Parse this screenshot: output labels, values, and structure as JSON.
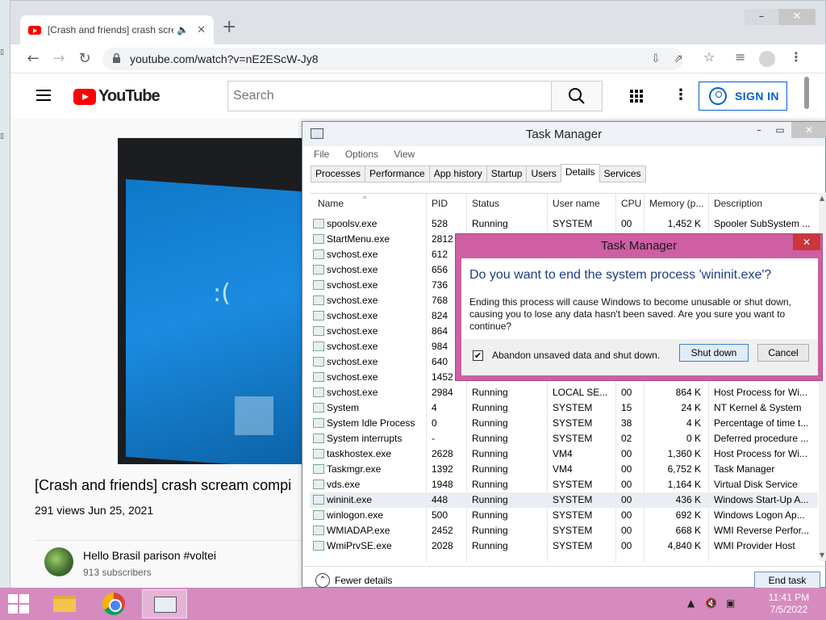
{
  "browser": {
    "tab_title": "[Crash and friends] crash scre",
    "new_tab": "+",
    "url": "youtube.com/watch?v=nE2EScW-Jy8",
    "window_min": "–",
    "window_close": "✕"
  },
  "youtube": {
    "logo_text": "YouTube",
    "search_placeholder": "Search",
    "signin_label": "SIGN IN",
    "video_title": "[Crash and friends] crash scream compi",
    "video_meta": "291 views  Jun 25, 2021",
    "channel_name": "Hello Brasil parison #voltei",
    "channel_subs": "913 subscribers"
  },
  "taskmanager": {
    "title": "Task Manager",
    "menu": [
      "File",
      "Options",
      "View"
    ],
    "tabs": [
      "Processes",
      "Performance",
      "App history",
      "Startup",
      "Users",
      "Details",
      "Services"
    ],
    "active_tab": "Details",
    "columns": [
      "Name",
      "PID",
      "Status",
      "User name",
      "CPU",
      "Memory (p...",
      "Description"
    ],
    "rows": [
      {
        "name": "spoolsv.exe",
        "pid": "528",
        "status": "Running",
        "user": "SYSTEM",
        "cpu": "00",
        "mem": "1,452 K",
        "desc": "Spooler SubSystem ..."
      },
      {
        "name": "StartMenu.exe",
        "pid": "2812",
        "status": "",
        "user": "",
        "cpu": "",
        "mem": "",
        "desc": ""
      },
      {
        "name": "svchost.exe",
        "pid": "612",
        "status": "",
        "user": "",
        "cpu": "",
        "mem": "",
        "desc": ""
      },
      {
        "name": "svchost.exe",
        "pid": "656",
        "status": "",
        "user": "",
        "cpu": "",
        "mem": "",
        "desc": ""
      },
      {
        "name": "svchost.exe",
        "pid": "736",
        "status": "",
        "user": "",
        "cpu": "",
        "mem": "",
        "desc": ""
      },
      {
        "name": "svchost.exe",
        "pid": "768",
        "status": "",
        "user": "",
        "cpu": "",
        "mem": "",
        "desc": ""
      },
      {
        "name": "svchost.exe",
        "pid": "824",
        "status": "",
        "user": "",
        "cpu": "",
        "mem": "",
        "desc": ""
      },
      {
        "name": "svchost.exe",
        "pid": "864",
        "status": "",
        "user": "",
        "cpu": "",
        "mem": "",
        "desc": ""
      },
      {
        "name": "svchost.exe",
        "pid": "984",
        "status": "",
        "user": "",
        "cpu": "",
        "mem": "",
        "desc": ""
      },
      {
        "name": "svchost.exe",
        "pid": "640",
        "status": "",
        "user": "",
        "cpu": "",
        "mem": "",
        "desc": ""
      },
      {
        "name": "svchost.exe",
        "pid": "1452",
        "status": "",
        "user": "",
        "cpu": "",
        "mem": "",
        "desc": ""
      },
      {
        "name": "svchost.exe",
        "pid": "2984",
        "status": "Running",
        "user": "LOCAL SE...",
        "cpu": "00",
        "mem": "864 K",
        "desc": "Host Process for Wi..."
      },
      {
        "name": "System",
        "pid": "4",
        "status": "Running",
        "user": "SYSTEM",
        "cpu": "15",
        "mem": "24 K",
        "desc": "NT Kernel & System"
      },
      {
        "name": "System Idle Process",
        "pid": "0",
        "status": "Running",
        "user": "SYSTEM",
        "cpu": "38",
        "mem": "4 K",
        "desc": "Percentage of time t..."
      },
      {
        "name": "System interrupts",
        "pid": "-",
        "status": "Running",
        "user": "SYSTEM",
        "cpu": "02",
        "mem": "0 K",
        "desc": "Deferred procedure ..."
      },
      {
        "name": "taskhostex.exe",
        "pid": "2628",
        "status": "Running",
        "user": "VM4",
        "cpu": "00",
        "mem": "1,360 K",
        "desc": "Host Process for Wi..."
      },
      {
        "name": "Taskmgr.exe",
        "pid": "1392",
        "status": "Running",
        "user": "VM4",
        "cpu": "00",
        "mem": "6,752 K",
        "desc": "Task Manager"
      },
      {
        "name": "vds.exe",
        "pid": "1948",
        "status": "Running",
        "user": "SYSTEM",
        "cpu": "00",
        "mem": "1,164 K",
        "desc": "Virtual Disk Service"
      },
      {
        "name": "wininit.exe",
        "pid": "448",
        "status": "Running",
        "user": "SYSTEM",
        "cpu": "00",
        "mem": "436 K",
        "desc": "Windows Start-Up A..."
      },
      {
        "name": "winlogon.exe",
        "pid": "500",
        "status": "Running",
        "user": "SYSTEM",
        "cpu": "00",
        "mem": "692 K",
        "desc": "Windows Logon Ap..."
      },
      {
        "name": "WMIADAP.exe",
        "pid": "2452",
        "status": "Running",
        "user": "SYSTEM",
        "cpu": "00",
        "mem": "668 K",
        "desc": "WMI Reverse Perfor..."
      },
      {
        "name": "WmiPrvSE.exe",
        "pid": "2028",
        "status": "Running",
        "user": "SYSTEM",
        "cpu": "00",
        "mem": "4,840 K",
        "desc": "WMI Provider Host"
      }
    ],
    "selected_row": "wininit.exe",
    "fewer_details": "Fewer details",
    "end_task": "End task"
  },
  "dialog": {
    "title": "Task Manager",
    "question": "Do you want to end the system process 'wininit.exe'?",
    "body": "Ending this process will cause Windows to become unusable or shut down, causing you to lose any data hasn't been saved. Are you sure you want to continue?",
    "checkbox_label": "Abandon unsaved data and shut down.",
    "checkbox_checked": true,
    "shutdown_label": "Shut down",
    "cancel_label": "Cancel"
  },
  "taskbar": {
    "time": "11:41 PM",
    "date": "7/5/2022"
  },
  "colors": {
    "dialog_frame": "#cd5fa2",
    "taskbar": "#d68bc0",
    "youtube_red": "#ff0000",
    "signin_blue": "#065fd4"
  }
}
